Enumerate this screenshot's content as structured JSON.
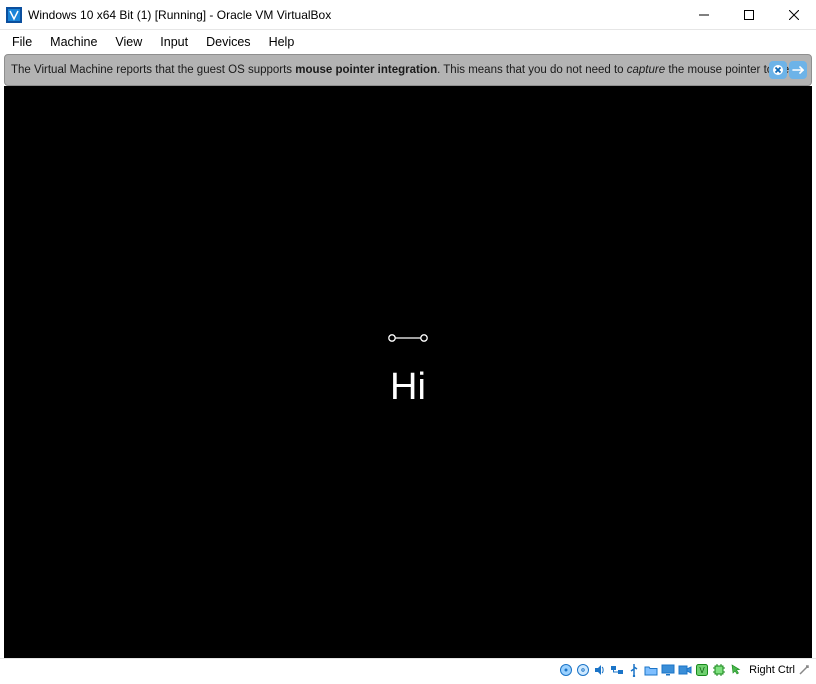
{
  "window": {
    "title": "Windows 10 x64 Bit (1) [Running] - Oracle VM VirtualBox"
  },
  "menus": [
    "File",
    "Machine",
    "View",
    "Input",
    "Devices",
    "Help"
  ],
  "infobar": {
    "pre": "The Virtual Machine reports that the guest OS supports ",
    "bold": "mouse pointer integration",
    "mid": ". This means that you do not need to ",
    "italic": "capture",
    "post": " the mouse pointer to be able to"
  },
  "guest": {
    "greeting": "Hi"
  },
  "statusbar": {
    "hostkey": "Right Ctrl",
    "icons": [
      "harddisk",
      "optical",
      "network",
      "usb",
      "shared-folders",
      "display",
      "recording",
      "audio",
      "cpu",
      "vm-state",
      "clipboard"
    ]
  }
}
